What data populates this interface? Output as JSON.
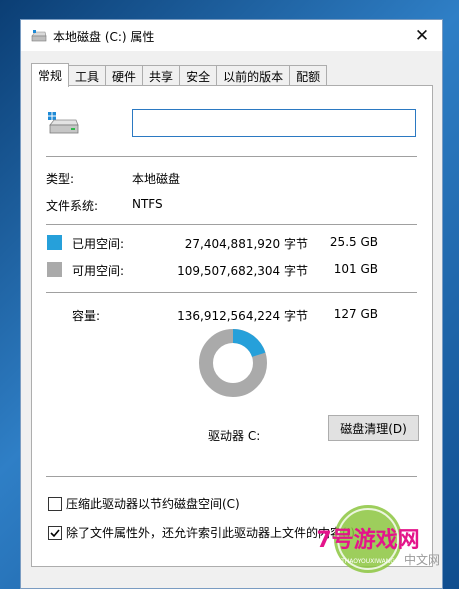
{
  "window": {
    "title": "本地磁盘 (C:) 属性",
    "close_glyph": "✕"
  },
  "tabs": [
    {
      "label": "常规",
      "active": true
    },
    {
      "label": "工具",
      "active": false
    },
    {
      "label": "硬件",
      "active": false
    },
    {
      "label": "共享",
      "active": false
    },
    {
      "label": "安全",
      "active": false
    },
    {
      "label": "以前的版本",
      "active": false
    },
    {
      "label": "配额",
      "active": false
    }
  ],
  "general": {
    "volume_label_value": "",
    "type_label": "类型:",
    "type_value": "本地磁盘",
    "fs_label": "文件系统:",
    "fs_value": "NTFS",
    "used": {
      "label": "已用空间:",
      "bytes": "27,404,881,920 字节",
      "size": "25.5 GB",
      "color": "#26a0da"
    },
    "free": {
      "label": "可用空间:",
      "bytes": "109,507,682,304 字节",
      "size": "101 GB",
      "color": "#aaaaaa"
    },
    "capacity": {
      "label": "容量:",
      "bytes": "136,912,564,224 字节",
      "size": "127 GB"
    },
    "used_fraction": 0.2,
    "drive_caption": "驱动器 C:",
    "cleanup_button": "磁盘清理(D)",
    "compress_checkbox": {
      "label": "压缩此驱动器以节约磁盘空间(C)",
      "checked": false
    },
    "index_checkbox": {
      "label": "除了文件属性外，还允许索引此驱动器上文件的内容(I)",
      "checked": true
    }
  },
  "watermark": {
    "logo_text": "7号游戏网",
    "sub_text": "THAOYOUXIWANG",
    "side_text": "中文网"
  },
  "icons": {
    "title_icon": "drive-icon",
    "drive_icon": "hard-drive-icon",
    "close_icon": "close-icon"
  }
}
